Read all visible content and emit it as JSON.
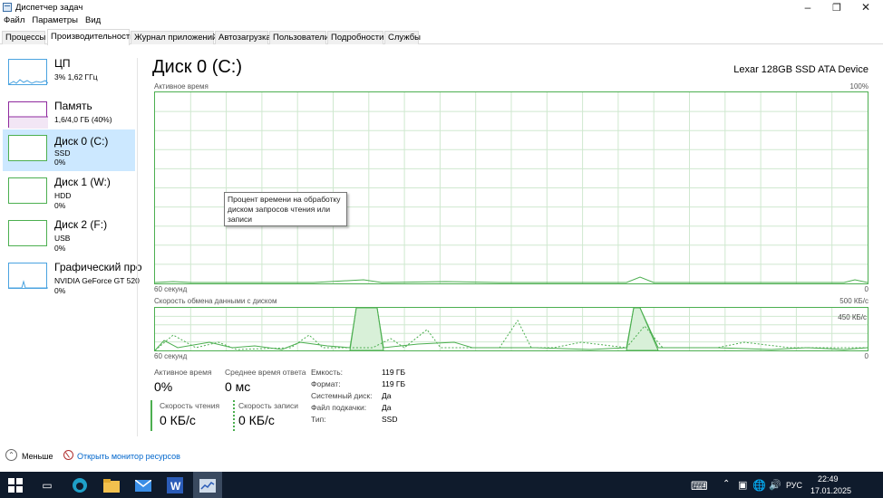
{
  "window": {
    "title": "Диспетчер задач"
  },
  "menu": {
    "items": [
      "Файл",
      "Параметры",
      "Вид"
    ]
  },
  "tabs": [
    "Процессы",
    "Производительность",
    "Журнал приложений",
    "Автозагрузка",
    "Пользователи",
    "Подробности",
    "Службы"
  ],
  "active_tab": "Производительность",
  "resources": [
    {
      "name": "ЦП",
      "sub": "3% 1,62 ГГц",
      "val": ""
    },
    {
      "name": "Память",
      "sub": "1,6/4,0 ГБ (40%)",
      "val": ""
    },
    {
      "name": "Диск 0 (C:)",
      "sub": "SSD",
      "val": "0%"
    },
    {
      "name": "Диск 1 (W:)",
      "sub": "HDD",
      "val": "0%"
    },
    {
      "name": "Диск 2 (F:)",
      "sub": "USB",
      "val": "0%"
    },
    {
      "name": "Графический про",
      "sub": "NVIDIA GeForce GT 520",
      "val": "0%"
    }
  ],
  "main": {
    "title": "Диск 0 (C:)",
    "device": "Lexar 128GB SSD ATA Device",
    "graph1": {
      "label": "Активное время",
      "max": "100%",
      "time_left": "60 секунд",
      "time_right": "0"
    },
    "tooltip": "Процент времени на обработку диском запросов чтения или записи",
    "graph2": {
      "label": "Скорость обмена данными с диском",
      "max": "500 КБ/с",
      "mark": "450 КБ/с",
      "time_left": "60 секунд",
      "time_right": "0"
    }
  },
  "stats": {
    "active_label": "Активное время",
    "active_value": "0%",
    "resp_label": "Среднее время ответа",
    "resp_value": "0 мс",
    "read_label": "Скорость чтения",
    "read_value": "0 КБ/с",
    "write_label": "Скорость записи",
    "write_value": "0 КБ/с"
  },
  "properties": [
    {
      "label": "Емкость:",
      "value": "119 ГБ"
    },
    {
      "label": "Формат:",
      "value": "119 ГБ"
    },
    {
      "label": "Системный диск:",
      "value": "Да"
    },
    {
      "label": "Файл подкачки:",
      "value": "Да"
    },
    {
      "label": "Тип:",
      "value": "SSD"
    }
  ],
  "footer": {
    "fewer": "Меньше",
    "monitor": "Открыть монитор ресурсов"
  },
  "taskbar": {
    "lang": "РУС",
    "time": "22:49",
    "date": "17.01.2025"
  },
  "colors": {
    "disk": "#4caf50",
    "cpu": "#4aa3e0",
    "memory": "#8f2a9e",
    "selected": "#cce8ff",
    "taskbar": "#0f1b2c"
  }
}
